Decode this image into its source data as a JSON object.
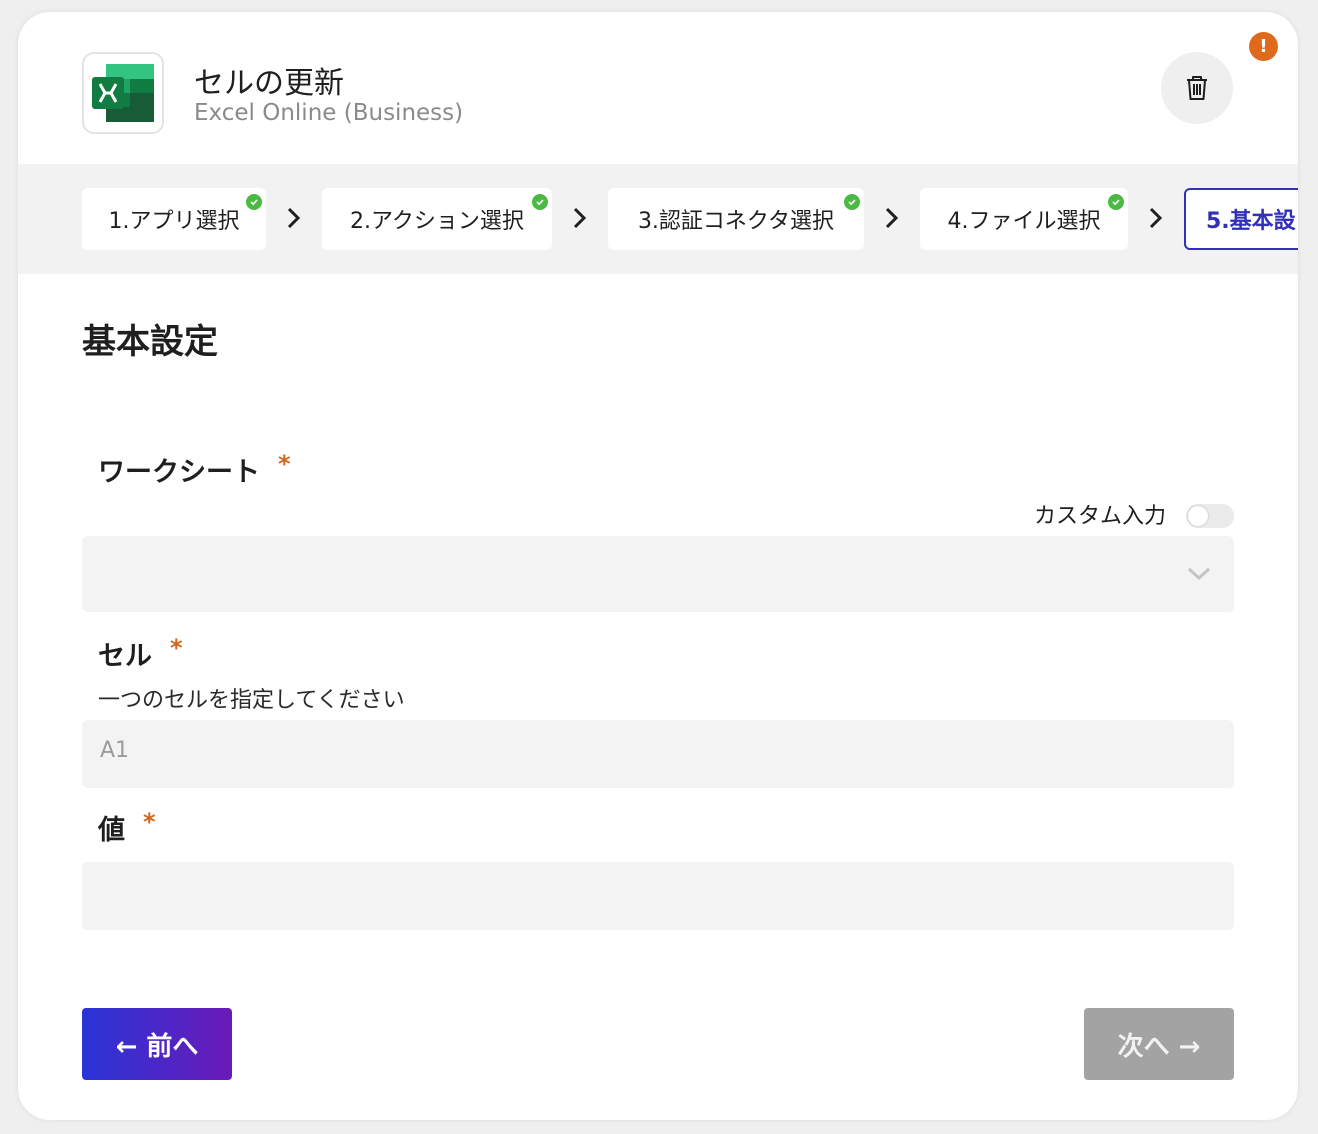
{
  "header": {
    "title": "セルの更新",
    "subtitle": "Excel Online (Business)",
    "app_icon": "excel-icon",
    "delete_icon": "trash-icon",
    "alert_badge": "!"
  },
  "stepper": {
    "steps": [
      {
        "label": "1.アプリ選択",
        "done": true
      },
      {
        "label": "2.アクション選択",
        "done": true
      },
      {
        "label": "3.認証コネクタ選択",
        "done": true
      },
      {
        "label": "4.ファイル選択",
        "done": true
      },
      {
        "label": "5.基本設",
        "done": false,
        "active": true
      }
    ]
  },
  "section": {
    "title": "基本設定"
  },
  "fields": {
    "worksheet": {
      "label": "ワークシート",
      "required_mark": "*",
      "custom_input_label": "カスタム入力",
      "custom_input_enabled": false,
      "value": ""
    },
    "cell": {
      "label": "セル",
      "required_mark": "*",
      "helper": "一つのセルを指定してください",
      "placeholder": "A1",
      "value": ""
    },
    "value": {
      "label": "値",
      "required_mark": "*",
      "value": ""
    }
  },
  "footer": {
    "prev_label": "← 前へ",
    "next_label": "次へ →"
  },
  "colors": {
    "accent": "#3030b8",
    "required": "#d5651c",
    "check": "#4cb944",
    "alert": "#e06a1b",
    "next_disabled": "#a3a3a3"
  }
}
